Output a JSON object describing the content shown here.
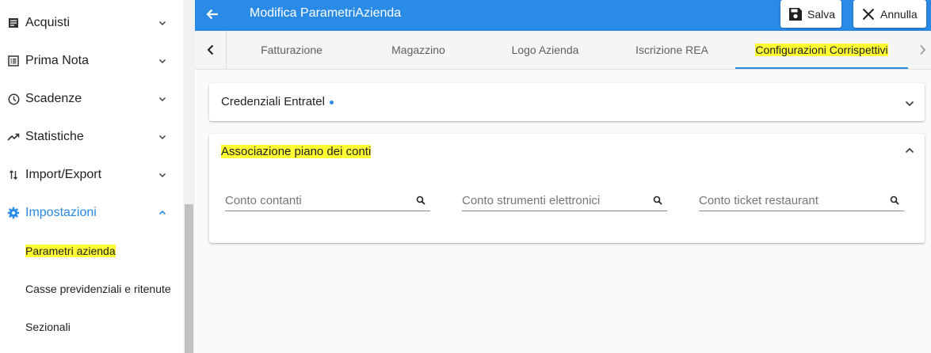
{
  "sidebar": {
    "items": [
      {
        "label": "Acquisti",
        "icon": "receipt-icon"
      },
      {
        "label": "Prima Nota",
        "icon": "list-icon"
      },
      {
        "label": "Scadenze",
        "icon": "clock-icon"
      },
      {
        "label": "Statistiche",
        "icon": "trending-up-icon"
      },
      {
        "label": "Import/Export",
        "icon": "swap-vert-icon"
      },
      {
        "label": "Impostazioni",
        "icon": "gear-icon"
      }
    ],
    "subitems": [
      {
        "label": "Parametri azienda"
      },
      {
        "label": "Casse previdenziali e ritenute"
      },
      {
        "label": "Sezionali"
      }
    ]
  },
  "header": {
    "title": "Modifica ParametriAzienda",
    "save_label": "Salva",
    "cancel_label": "Annulla"
  },
  "tabs": [
    {
      "label": "Fatturazione"
    },
    {
      "label": "Magazzino"
    },
    {
      "label": "Logo Azienda"
    },
    {
      "label": "Iscrizione REA"
    },
    {
      "label": "Configurazioni Corrispettivi"
    }
  ],
  "panels": {
    "credentials": {
      "title": "Credenziali Entratel"
    },
    "accounts": {
      "title": "Associazione piano dei conti",
      "fields": [
        {
          "placeholder": "Conto contanti",
          "value": ""
        },
        {
          "placeholder": "Conto strumenti elettronici",
          "value": ""
        },
        {
          "placeholder": "Conto ticket restaurant",
          "value": ""
        }
      ]
    }
  },
  "colors": {
    "primary": "#2a8be6",
    "highlight": "#ffff33"
  }
}
